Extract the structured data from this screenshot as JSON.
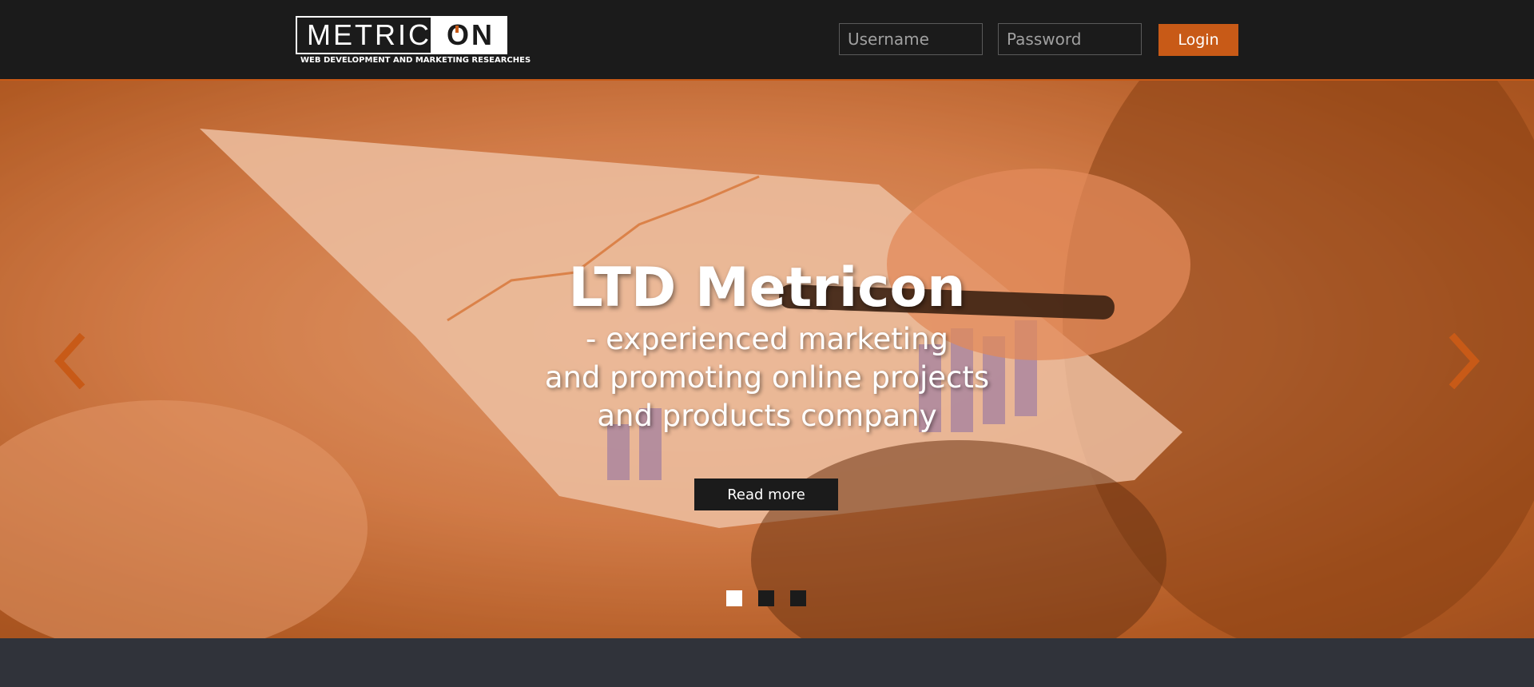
{
  "header": {
    "logo": {
      "text_left": "METRIC",
      "text_right": "ON",
      "tagline": "WEB DEVELOPMENT AND MARKETING RESEARCHES"
    },
    "login_form": {
      "username_placeholder": "Username",
      "password_placeholder": "Password",
      "login_label": "Login"
    }
  },
  "hero": {
    "title": "LTD Metricon",
    "subtitle_lines": [
      "- experienced marketing",
      "and promoting online projects",
      "and products company"
    ],
    "read_more_label": "Read more",
    "prev_arrow_icon": "chevron-left-icon",
    "next_arrow_icon": "chevron-right-icon",
    "slide_count": 3,
    "active_slide": 1
  },
  "colors": {
    "accent": "#c85a17",
    "header_bg": "#1b1b1b",
    "page_bg": "#30333a",
    "text_light": "#ffffff"
  }
}
